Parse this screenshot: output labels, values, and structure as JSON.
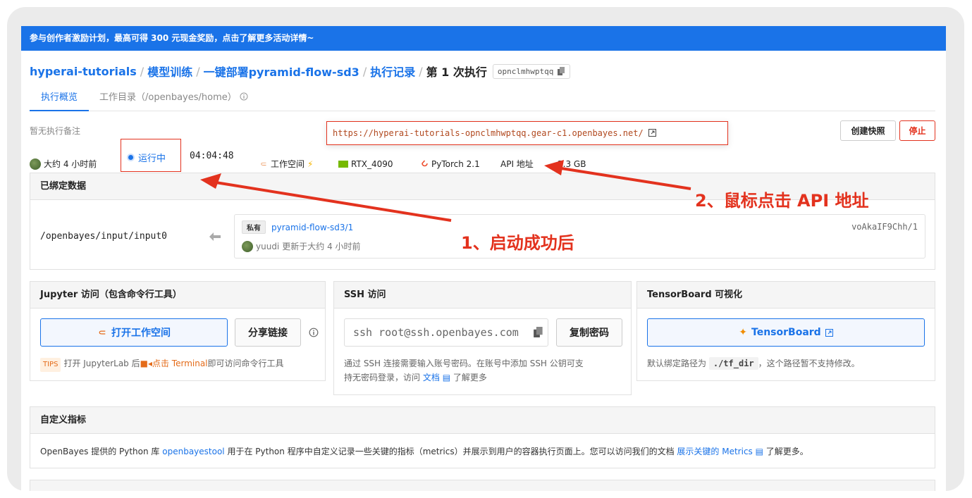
{
  "banner": {
    "text": "参与创作者激励计划，最高可得 300 元现金奖励，点击了解更多活动详情~"
  },
  "breadcrumb": {
    "items": [
      "hyperai-tutorials",
      "模型训练",
      "一键部署pyramid-flow-sd3",
      "执行记录"
    ],
    "current": "第 1 次执行",
    "run_id": "opnclmhwptqq"
  },
  "tabs": {
    "overview": "执行概览",
    "workdir": "工作目录（/openbayes/home）"
  },
  "note": "暂无执行备注",
  "api_url": "https://hyperai-tutorials-opnclmhwptqq.gear-c1.openbayes.net/",
  "actions": {
    "snapshot": "创建快照",
    "stop": "停止"
  },
  "meta": {
    "created": "大约 4 小时前",
    "status": "运行中",
    "elapsed": "04:04:48",
    "workspace": "工作空间",
    "gpu": "RTX_4090",
    "framework": "PyTorch 2.1",
    "api": "API 地址",
    "size": "2.3 GB"
  },
  "bound_data": {
    "title": "已绑定数据",
    "mount_path": "/openbayes/input/input0",
    "private_tag": "私有",
    "dataset": "pyramid-flow-sd3/1",
    "version": "voAkaIF9Chh/1",
    "user": "yuudi",
    "updated": "更新于大约 4 小时前"
  },
  "jupyter": {
    "title": "Jupyter 访问（包含命令行工具）",
    "open_label": "打开工作空间",
    "share_label": "分享链接",
    "tips_tag": "TIPS",
    "tips_before": "打开 JupyterLab 后",
    "tips_click": "点击 Terminal",
    "tips_after": "即可访问命令行工具"
  },
  "ssh": {
    "title": "SSH 访问",
    "command": "ssh root@ssh.openbayes.com",
    "copy_label": "复制密码",
    "desc_1": "通过 SSH 连接需要输入账号密码。在账号中添加 SSH 公钥可支",
    "desc_2": "持无密码登录，访问",
    "doc_link": "文档",
    "desc_3": "了解更多"
  },
  "tensorboard": {
    "title": "TensorBoard 可视化",
    "button": "TensorBoard",
    "desc_1": "默认绑定路径为",
    "path": "./tf_dir",
    "desc_2": "，这个路径暂不支持修改。"
  },
  "metrics": {
    "title": "自定义指标",
    "text_1": "OpenBayes 提供的 Python 库",
    "lib": "openbayestool",
    "text_2": "用于在 Python 程序中自定义记录一些关键的指标（metrics）并展示到用户的容器执行页面上。您可以访问我们的文档",
    "link": "展示关键的 Metrics",
    "text_3": "了解更多。"
  },
  "annotations": {
    "step1": "1、启动成功后",
    "step2": "2、鼠标点击 API 地址"
  },
  "colors": {
    "primary": "#1a73e8",
    "danger": "#e3321e",
    "orange": "#e46b19"
  }
}
